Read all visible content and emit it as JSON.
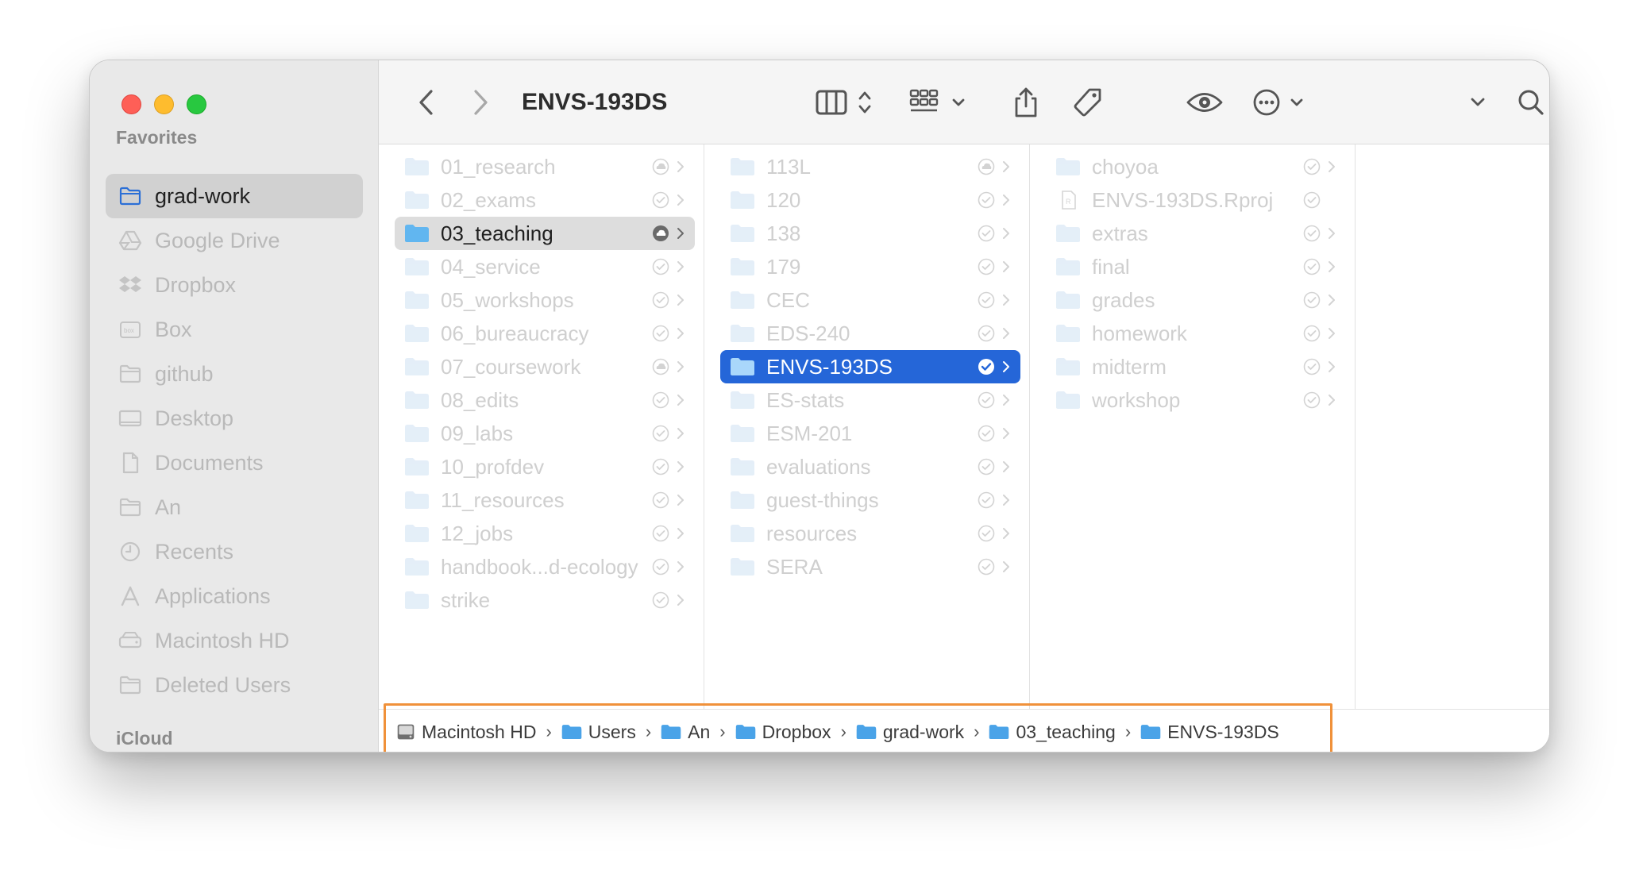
{
  "window": {
    "title": "ENVS-193DS"
  },
  "colors": {
    "accent": "#2566d8",
    "folder": "#62b6f0",
    "highlight": "#f0913a"
  },
  "sidebar": {
    "favorites_header": "Favorites",
    "icloud_header": "iCloud",
    "items": [
      {
        "label": "grad-work",
        "icon": "folder-icon",
        "selected": true
      },
      {
        "label": "Google Drive",
        "icon": "google-drive-icon"
      },
      {
        "label": "Dropbox",
        "icon": "dropbox-icon"
      },
      {
        "label": "Box",
        "icon": "box-icon"
      },
      {
        "label": "github",
        "icon": "folder-icon"
      },
      {
        "label": "Desktop",
        "icon": "desktop-icon"
      },
      {
        "label": "Documents",
        "icon": "document-icon"
      },
      {
        "label": "An",
        "icon": "folder-icon"
      },
      {
        "label": "Recents",
        "icon": "clock-icon"
      },
      {
        "label": "Applications",
        "icon": "applications-icon"
      },
      {
        "label": "Macintosh HD",
        "icon": "drive-icon"
      },
      {
        "label": "Deleted Users",
        "icon": "folder-icon"
      }
    ]
  },
  "toolbar": {
    "back": "back-icon",
    "forward": "forward-icon",
    "view_columns": "columns-view-icon",
    "group": "group-grid-icon",
    "share": "share-icon",
    "tag": "tag-icon",
    "quicklook": "eye-icon",
    "more": "ellipsis-circle-icon",
    "expand": "chevron-down-icon",
    "search": "search-icon"
  },
  "columns": [
    {
      "items": [
        {
          "name": "01_research",
          "status": "cloud"
        },
        {
          "name": "02_exams",
          "status": "check"
        },
        {
          "name": "03_teaching",
          "status": "cloud",
          "selected": "grey"
        },
        {
          "name": "04_service",
          "status": "check"
        },
        {
          "name": "05_workshops",
          "status": "check"
        },
        {
          "name": "06_bureaucracy",
          "status": "check"
        },
        {
          "name": "07_coursework",
          "status": "cloud"
        },
        {
          "name": "08_edits",
          "status": "check"
        },
        {
          "name": "09_labs",
          "status": "check"
        },
        {
          "name": "10_profdev",
          "status": "check"
        },
        {
          "name": "11_resources",
          "status": "check"
        },
        {
          "name": "12_jobs",
          "status": "check"
        },
        {
          "name": "handbook...d-ecology",
          "status": "check"
        },
        {
          "name": "strike",
          "status": "check"
        }
      ]
    },
    {
      "items": [
        {
          "name": "113L",
          "status": "cloud"
        },
        {
          "name": "120",
          "status": "check"
        },
        {
          "name": "138",
          "status": "check"
        },
        {
          "name": "179",
          "status": "check"
        },
        {
          "name": "CEC",
          "status": "check"
        },
        {
          "name": "EDS-240",
          "status": "check"
        },
        {
          "name": "ENVS-193DS",
          "status": "check",
          "selected": "blue"
        },
        {
          "name": "ES-stats",
          "status": "check"
        },
        {
          "name": "ESM-201",
          "status": "check"
        },
        {
          "name": "evaluations",
          "status": "check"
        },
        {
          "name": "guest-things",
          "status": "check"
        },
        {
          "name": "resources",
          "status": "check"
        },
        {
          "name": "SERA",
          "status": "check"
        }
      ]
    },
    {
      "items": [
        {
          "name": "choyoa",
          "status": "check",
          "folder": true
        },
        {
          "name": "ENVS-193DS.Rproj",
          "status": "check",
          "folder": false
        },
        {
          "name": "extras",
          "status": "check",
          "folder": true
        },
        {
          "name": "final",
          "status": "check",
          "folder": true
        },
        {
          "name": "grades",
          "status": "check",
          "folder": true
        },
        {
          "name": "homework",
          "status": "check",
          "folder": true
        },
        {
          "name": "midterm",
          "status": "check",
          "folder": true
        },
        {
          "name": "workshop",
          "status": "check",
          "folder": true
        }
      ]
    }
  ],
  "pathbar": [
    {
      "label": "Macintosh HD",
      "icon": "hard-drive-icon"
    },
    {
      "label": "Users",
      "icon": "users-folder-icon"
    },
    {
      "label": "An",
      "icon": "home-folder-icon"
    },
    {
      "label": "Dropbox",
      "icon": "dropbox-folder-icon"
    },
    {
      "label": "grad-work",
      "icon": "folder-icon"
    },
    {
      "label": "03_teaching",
      "icon": "folder-icon"
    },
    {
      "label": "ENVS-193DS",
      "icon": "folder-icon"
    }
  ]
}
